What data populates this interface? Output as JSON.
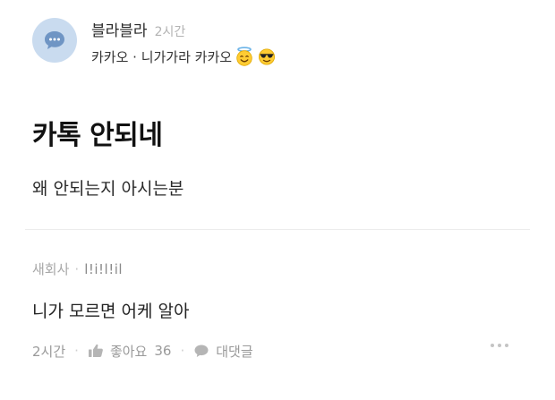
{
  "post": {
    "author": "블라블라",
    "time": "2시간",
    "board": "카카오 · 니가가라 카카오",
    "board_emojis": [
      "halo-smile-emoji",
      "sunglasses-emoji"
    ],
    "title": "카톡 안되네",
    "body": "왜 안되는지 아시는분"
  },
  "comment": {
    "company": "새회사",
    "separator": "·",
    "nickname": "l!i!l!il",
    "text": "니가 모르면 어케 알아",
    "time": "2시간",
    "like_label": "좋아요",
    "like_count": "36",
    "reply_label": "대댓글"
  },
  "colors": {
    "avatar_bg": "#c9dbef",
    "avatar_icon": "#6f95c4",
    "muted_text": "#9a9a9a"
  }
}
